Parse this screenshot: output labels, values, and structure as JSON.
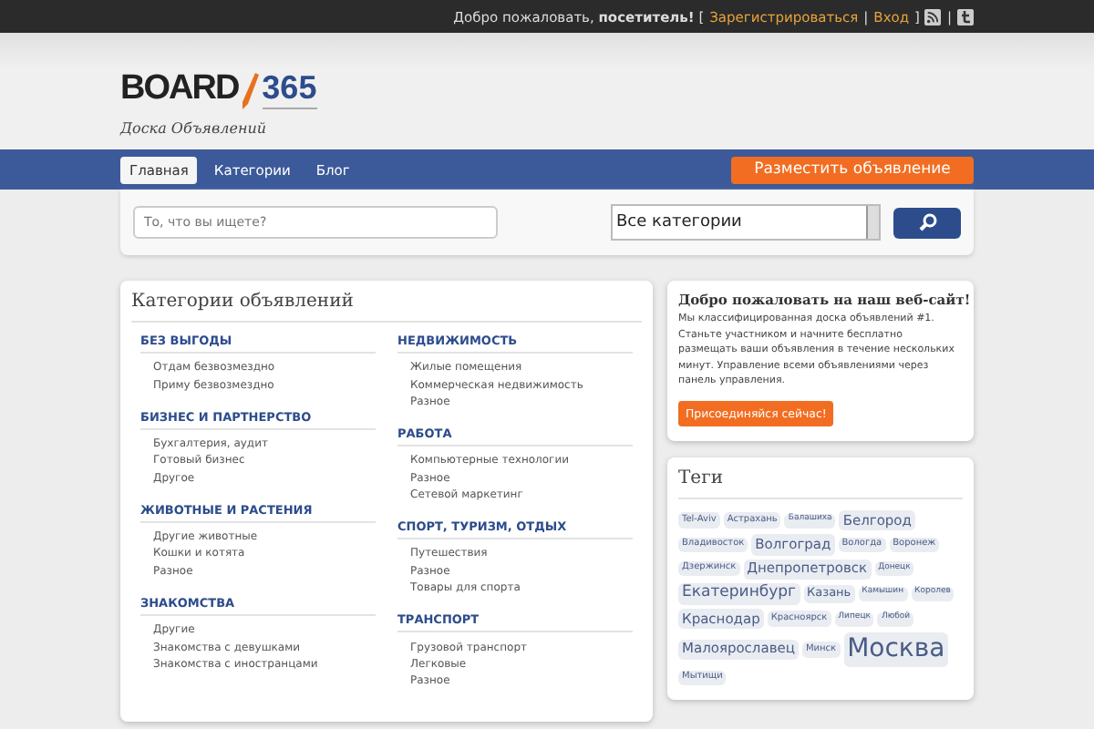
{
  "topbar": {
    "greeting": "Добро пожаловать, **посетитель!** [",
    "links": [
      {
        "label": "Зарегистрироваться"
      },
      {
        "label": "Вход"
      }
    ],
    "separator": "|",
    "close": "]"
  },
  "header": {
    "logo_word": "BOARD",
    "logo_number": "365",
    "tagline": "Доска Объявлений"
  },
  "nav": {
    "items": [
      {
        "label": "Главная",
        "selected": true
      },
      {
        "label": "Категории",
        "selected": false
      },
      {
        "label": "Блог",
        "selected": false
      }
    ],
    "post_button": "Разместить объявление"
  },
  "search": {
    "placeholder": "То, что вы ищете?",
    "category": "Все категории"
  },
  "categories": {
    "title": "Категории объявлений",
    "columns": [
      [
        {
          "name": "БЕЗ ВЫГОДЫ",
          "items": [
            "Отдам безвозмездно",
            "Приму безвозмездно"
          ]
        },
        {
          "name": "БИЗНЕС И ПАРТНЕРСТВО",
          "items": [
            "Бухгалтерия, аудит",
            "Готовый бизнес",
            "Другое"
          ]
        },
        {
          "name": "ЖИВОТНЫЕ И РАСТЕНИЯ",
          "items": [
            "Другие животные",
            "Кошки и котята",
            "Разное"
          ]
        },
        {
          "name": "ЗНАКОМСТВА",
          "items": [
            "Другие",
            "Знакомства с девушками",
            "Знакомства с иностранцами"
          ]
        }
      ],
      [
        {
          "name": "НЕДВИЖИМОСТЬ",
          "items": [
            "Жилые помещения",
            "Коммерческая недвижимость",
            "Разное"
          ]
        },
        {
          "name": "РАБОТА",
          "items": [
            "Компьютерные технологии",
            "Разное",
            "Сетевой маркетинг"
          ]
        },
        {
          "name": "СПОРТ, ТУРИЗМ, ОТДЫХ",
          "items": [
            "Путешествия",
            "Разное",
            "Товары для спорта"
          ]
        },
        {
          "name": "ТРАНСПОРТ",
          "items": [
            "Грузовой транспорт",
            "Легковые",
            "Разное"
          ]
        }
      ]
    ]
  },
  "welcome": {
    "title": "Добро пожаловать на наш веб-сайт!",
    "text": "Мы классифицированная доска объявлений #1. Станьте участником и начните бесплатно размещать ваши объявления в течение нескольких минут. Управление всеми объявлениями через панель управления.",
    "button": "Присоединяйся сейчас!"
  },
  "tags": {
    "title": "Теги",
    "items": [
      {
        "label": "Tel-Aviv",
        "kind": "s"
      },
      {
        "label": "Астрахань",
        "kind": "s"
      },
      {
        "label": "Балашиха",
        "kind": "xs"
      },
      {
        "label": "Белгород",
        "kind": "l"
      },
      {
        "label": "Владивосток",
        "kind": "s"
      },
      {
        "label": "Волгоград",
        "kind": "l"
      },
      {
        "label": "Вологда",
        "kind": "s"
      },
      {
        "label": "Воронеж",
        "kind": "s"
      },
      {
        "label": "Дзержинск",
        "kind": "s"
      },
      {
        "label": "Днепропетровск",
        "kind": "l"
      },
      {
        "label": "Донецк",
        "kind": "xs"
      },
      {
        "label": "Екатеринбург",
        "kind": "xl"
      },
      {
        "label": "Казань",
        "kind": "m"
      },
      {
        "label": "Камышин",
        "kind": "xs"
      },
      {
        "label": "Королев",
        "kind": "xs"
      },
      {
        "label": "Краснодар",
        "kind": "l"
      },
      {
        "label": "Красноярск",
        "kind": "s"
      },
      {
        "label": "Липецк",
        "kind": "xs"
      },
      {
        "label": "Любой",
        "kind": "xs"
      },
      {
        "label": "Малоярославец",
        "kind": "l"
      },
      {
        "label": "Минск",
        "kind": "s"
      },
      {
        "label": "Москва",
        "kind": "xxl"
      },
      {
        "label": "Мытищи",
        "kind": "s"
      }
    ]
  }
}
